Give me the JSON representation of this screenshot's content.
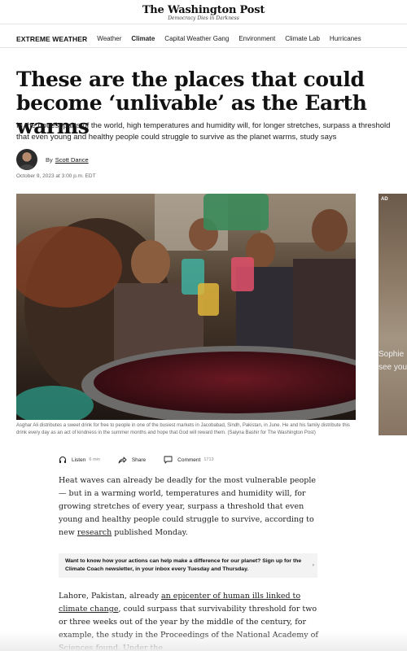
{
  "masthead": {
    "logo": "The Washington Post",
    "tagline": "Democracy Dies in Darkness"
  },
  "nav": {
    "brand": "EXTREME WEATHER",
    "items": [
      "Weather",
      "Climate",
      "Capital Weather Gang",
      "Environment",
      "Climate Lab",
      "Hurricanes"
    ],
    "active": "Climate"
  },
  "article": {
    "headline": "These are the places that could become ‘unlivable’ as the Earth warms",
    "dek": "In the hottest parts of the world, high temperatures and humidity will, for longer stretches, surpass a threshold that even young and healthy people could struggle to survive as the planet warms, study says",
    "by": "By",
    "author": "Scott Dance",
    "date": "October 9, 2023 at 3:00 p.m. EDT",
    "caption": "Asghar Ali distributes a sweet drink for free to people in one of the busiest markets in Jacobabad, Sindh, Pakistan, in June. He and his family distribute this drink every day as an act of kindness in the summer months and hope that God will reward them. (Saiyna Bashir for The Washington Post)",
    "p1_a": "Heat waves can already be deadly for the most vulnerable people — but in a warming world, temperatures and humidity will, for growing stretches of every year, surpass a threshold that even young and healthy people could struggle to survive, according to new ",
    "p1_link": "research",
    "p1_b": " published Monday.",
    "p2_a": "Lahore, Pakistan, already ",
    "p2_link": "an epicenter of human ills linked to climate change",
    "p2_b": ", could surpass that survivability threshold for two or three weeks out of the year by the middle of the century, for example, the study in the Proceedings of the National Academy of Sciences found. Under the"
  },
  "actions": {
    "listen": "Listen",
    "listen_duration": "6 min",
    "share": "Share",
    "comment": "Comment",
    "comment_count": "1713"
  },
  "promo": {
    "text": "Want to know how your actions can help make a difference for our planet? Sign up for the Climate Coach newsletter, in your inbox every Tuesday and Thursday.",
    "arrow": "›"
  },
  "ad": {
    "label": "AD",
    "line1": "Sophie",
    "line2": "see you"
  },
  "icons": {
    "listen": "headphones-icon",
    "share": "share-icon",
    "comment": "comment-icon"
  }
}
